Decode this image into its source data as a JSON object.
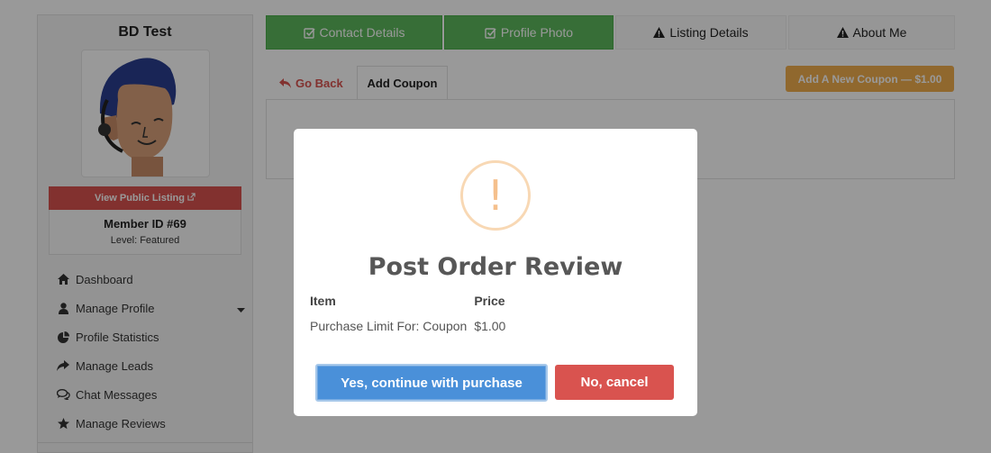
{
  "sidebar": {
    "profile_name": "BD Test",
    "view_listing_label": "View Public Listing",
    "member_id": "Member ID #69",
    "member_level": "Level: Featured",
    "nav": [
      {
        "label": "Dashboard",
        "icon": "home-icon"
      },
      {
        "label": "Manage Profile",
        "icon": "user-icon"
      },
      {
        "label": "Profile Statistics",
        "icon": "pie-chart-icon"
      },
      {
        "label": "Manage Leads",
        "icon": "share-icon"
      },
      {
        "label": "Chat Messages",
        "icon": "chat-icon"
      },
      {
        "label": "Manage Reviews",
        "icon": "star-icon"
      }
    ]
  },
  "tabs": {
    "contact": "Contact Details",
    "photo": "Profile Photo",
    "listing": "Listing Details",
    "about": "About Me"
  },
  "subtabs": {
    "go_back": "Go Back",
    "add_coupon": "Add Coupon"
  },
  "actions": {
    "add_new_coupon": "Add A New Coupon — $1.00"
  },
  "modal": {
    "icon": "!",
    "title": "Post Order Review",
    "columns": [
      "Item",
      "Price"
    ],
    "rows": [
      {
        "item": "Purchase Limit For: Coupon",
        "price": "$1.00"
      }
    ],
    "confirm_label": "Yes, continue with purchase",
    "cancel_label": "No, cancel"
  },
  "colors": {
    "success": "#5cb85c",
    "danger": "#d9534f",
    "warning": "#f0ad4e",
    "primary": "#4a90d9"
  }
}
